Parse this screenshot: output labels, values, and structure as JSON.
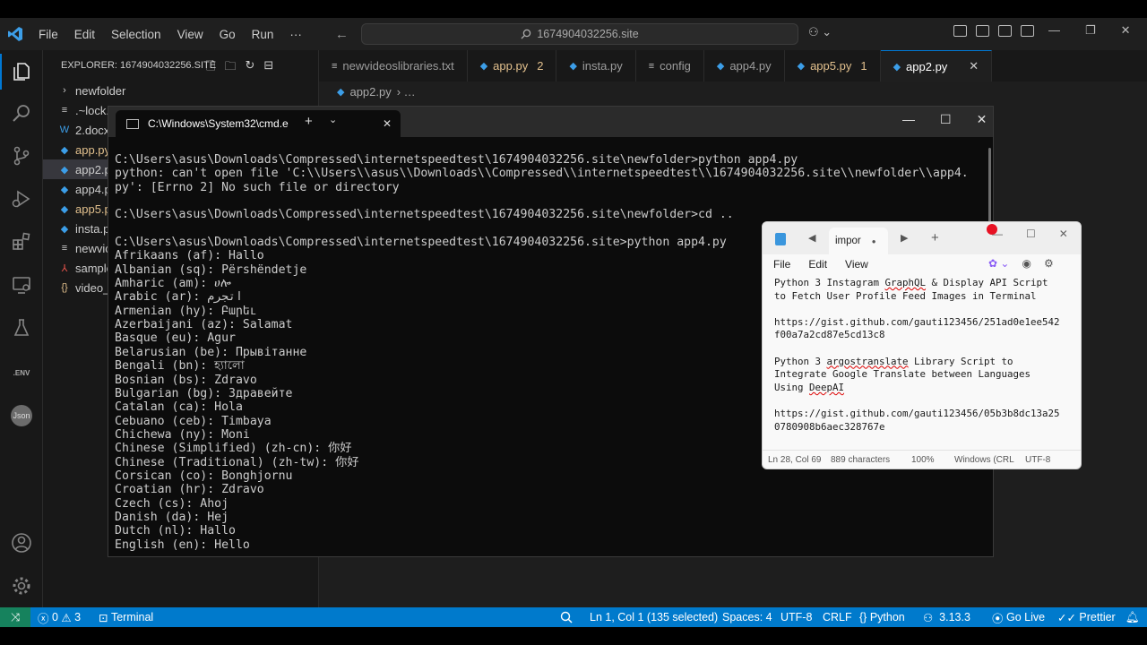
{
  "titlebar": {
    "menu": [
      "File",
      "Edit",
      "Selection",
      "View",
      "Go",
      "Run",
      "···"
    ],
    "search": "1674904032256.site"
  },
  "sidebar": {
    "header": "EXPLORER: 1674904032256.SITE",
    "items": [
      {
        "label": "newfolder",
        "icon": "chevron-right"
      },
      {
        "label": ".~lock.",
        "icon": "lines"
      },
      {
        "label": "2.docx",
        "icon": "word"
      },
      {
        "label": "app.py",
        "icon": "python"
      },
      {
        "label": "app2.p",
        "icon": "python"
      },
      {
        "label": "app4.py",
        "icon": "python"
      },
      {
        "label": "app5.p",
        "icon": "python"
      },
      {
        "label": "insta.p",
        "icon": "python"
      },
      {
        "label": "newvic",
        "icon": "lines"
      },
      {
        "label": "sample",
        "icon": "pdf"
      },
      {
        "label": "video_",
        "icon": "json"
      }
    ]
  },
  "tabs": [
    {
      "label": "newvideoslibraries.txt",
      "icon": "lines"
    },
    {
      "label": "app.py",
      "icon": "python",
      "count": "2",
      "modified": true
    },
    {
      "label": "insta.py",
      "icon": "python"
    },
    {
      "label": "config",
      "icon": "lines"
    },
    {
      "label": "app4.py",
      "icon": "python"
    },
    {
      "label": "app5.py",
      "icon": "python",
      "count": "1",
      "modified": true
    },
    {
      "label": "app2.py",
      "icon": "python",
      "active": true
    }
  ],
  "breadcrumb": {
    "file": "app2.py",
    "rest": "› …"
  },
  "statusbar": {
    "problems_errors": "0",
    "problems_warnings": "3",
    "terminal": "Terminal",
    "cursor": "Ln 1, Col 1 (135 selected)",
    "spaces": "Spaces: 4",
    "encoding": "UTF-8",
    "eol": "CRLF",
    "language": "Python",
    "version": "3.13.3",
    "golive": "Go Live",
    "prettier": "Prettier"
  },
  "cmd": {
    "tab_title": "C:\\Windows\\System32\\cmd.e",
    "lines": [
      "C:\\Users\\asus\\Downloads\\Compressed\\internetspeedtest\\1674904032256.site\\newfolder>python app4.py",
      "python: can't open file 'C:\\\\Users\\\\asus\\\\Downloads\\\\Compressed\\\\internetspeedtest\\\\1674904032256.site\\\\newfolder\\\\app4.",
      "py': [Errno 2] No such file or directory",
      "",
      "C:\\Users\\asus\\Downloads\\Compressed\\internetspeedtest\\1674904032256.site\\newfolder>cd ..",
      "",
      "C:\\Users\\asus\\Downloads\\Compressed\\internetspeedtest\\1674904032256.site>python app4.py",
      "Afrikaans (af): Hallo",
      "Albanian (sq): Përshëndetje",
      "Amharic (am): ሀሎ",
      "Arabic (ar): اتجرم",
      "Armenian (hy): Բարեւ",
      "Azerbaijani (az): Salamat",
      "Basque (eu): Agur",
      "Belarusian (be): Прывітанне",
      "Bengali (bn): হ্যালো",
      "Bosnian (bs): Zdravo",
      "Bulgarian (bg): Здравейте",
      "Catalan (ca): Hola",
      "Cebuano (ceb): Timbaya",
      "Chichewa (ny): Moni",
      "Chinese (Simplified) (zh-cn): 你好",
      "Chinese (Traditional) (zh-tw): 你好",
      "Corsican (co): Bonghjornu",
      "Croatian (hr): Zdravo",
      "Czech (cs): Ahoj",
      "Danish (da): Hej",
      "Dutch (nl): Hallo",
      "English (en): Hello"
    ]
  },
  "notepad": {
    "tab_title": "impor",
    "menu": [
      "File",
      "Edit",
      "View"
    ],
    "lines": [
      "Python 3 Instagram GraphQL & Display API Script",
      "to Fetch User Profile Feed Images in Terminal",
      "",
      "https://gist.github.com/gauti123456/251ad0e1ee542",
      "f00a7a2cd87e5cd13c8",
      "",
      "Python 3 argostranslate Library Script to",
      "Integrate Google Translate between Languages",
      "Using DeepAI",
      "",
      "https://gist.github.com/gauti123456/05b3b8dc13a25",
      "0780908b6aec328767e"
    ],
    "status": {
      "position": "Ln 28, Col 69",
      "chars": "889 characters",
      "zoom": "100%",
      "eol": "Windows (CRL",
      "encoding": "UTF-8"
    }
  }
}
